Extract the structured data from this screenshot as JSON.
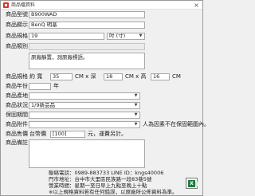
{
  "window": {
    "title": "商品檔資料"
  },
  "labels": {
    "model": "商品型號",
    "name": "商品顯示",
    "spec": "商品規格",
    "category": "商品類別",
    "note": "商品說明",
    "size": "商品規格",
    "year": "商品年份",
    "origin": "商品產地",
    "status": "商品狀況",
    "warranty": "保固期間",
    "accessory": "商品附件",
    "price": "商品售價",
    "remark": "商品備註"
  },
  "fields": {
    "model": "B900WAD",
    "name": "BenQ 明基",
    "spec_size": "19",
    "spec_unit": "吋 (寸)",
    "category": "",
    "note": "原廠靜置，測原廠標語。",
    "size_prefix": "約 寬",
    "width": "35",
    "size_sep1": "CM x 深",
    "depth": "18",
    "size_sep2": "CM x 高",
    "height": "16",
    "size_unit": "CM",
    "year": "年",
    "origin": "",
    "status": "1/9新品品",
    "warranty": "",
    "accessory": "",
    "accessory_note": "人為因素不在保固範圍內。",
    "price_prefix": "台幣價",
    "price": "[100]",
    "price_suffix": "元，運費另計。",
    "remark": ""
  },
  "contact": {
    "phone": "聯絡電話：0989-883733 LINE ID：kngs40006",
    "store": "門市地址：台中市大里區民族路一段83巷5號",
    "hours": "營業時間：星期一至日早上九點至晚上十點",
    "disclaimer": "※以上規格資料若有任何錯誤，以原廠所公佈資料為準。"
  },
  "icons": {
    "app": "app-icon",
    "close": "close-icon",
    "excel": "excel-icon"
  }
}
